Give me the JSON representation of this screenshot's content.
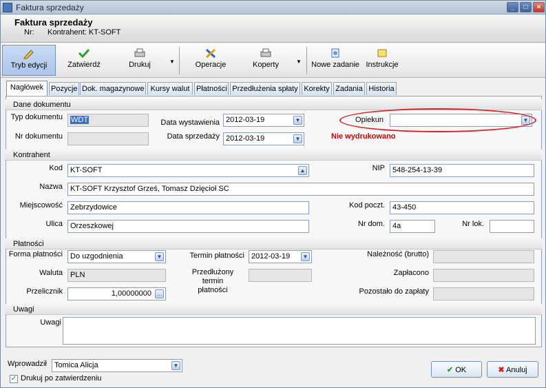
{
  "window": {
    "title": "Faktura sprzedaży",
    "controls": [
      "_",
      "□",
      "×"
    ]
  },
  "header": {
    "title": "Faktura sprzedaży",
    "nr_label": "Nr:",
    "kontrahent": "Kontrahent: KT-SOFT"
  },
  "toolbar": {
    "edit": "Tryb edycji",
    "approve": "Zatwierdź",
    "print": "Drukuj",
    "operations": "Operacje",
    "envelopes": "Koperty",
    "new_task": "Nowe zadanie",
    "instructions": "Instrukcje"
  },
  "tabs": [
    "Nagłówek",
    "Pozycje",
    "Dok. magazynowe",
    "Kursy walut",
    "Płatności",
    "Przedłużenia spłaty",
    "Korekty",
    "Zadania",
    "Historia"
  ],
  "dane": {
    "section": "Dane dokumentu",
    "typ_label": "Typ dokumentu",
    "typ_value": "WDT",
    "nr_label": "Nr dokumentu",
    "nr_value": "",
    "data_wyst_label": "Data wystawienia",
    "data_wyst_value": "2012-03-19",
    "data_sprz_label": "Data sprzedaży",
    "data_sprz_value": "2012-03-19",
    "opiekun_label": "Opiekun",
    "opiekun_value": "",
    "status": "Nie wydrukowano"
  },
  "kontrahent": {
    "section": "Kontrahent",
    "kod_label": "Kod",
    "kod_value": "KT-SOFT",
    "nip_label": "NIP",
    "nip_value": "548-254-13-39",
    "nazwa_label": "Nazwa",
    "nazwa_value": "KT-SOFT Krzysztof Grześ, Tomasz Dzięcioł SC",
    "miejsc_label": "Miejscowość",
    "miejsc_value": "Zebrzydowice",
    "kodp_label": "Kod poczt.",
    "kodp_value": "43-450",
    "ulica_label": "Ulica",
    "ulica_value": "Orzeszkowej",
    "nrdom_label": "Nr dom.",
    "nrdom_value": "4a",
    "nrlok_label": "Nr lok.",
    "nrlok_value": ""
  },
  "platnosci": {
    "section": "Płatności",
    "forma_label": "Forma płatności",
    "forma_value": "Do uzgodnienia",
    "termin_label": "Termin płatności",
    "termin_value": "2012-03-19",
    "naleznosc_label": "Należność (brutto)",
    "naleznosc_value": "",
    "waluta_label": "Waluta",
    "waluta_value": "PLN",
    "przedl_label1": "Przedłużony",
    "przedl_label2": "termin",
    "przedl_label3": "płatności",
    "przedl_value": "",
    "zaplacono_label": "Zapłacono",
    "zaplacono_value": "",
    "przelicznik_label": "Przelicznik",
    "przelicznik_value": "1,00000000",
    "pozostalo_label": "Pozostało do zapłaty",
    "pozostalo_value": ""
  },
  "uwagi": {
    "section": "Uwagi",
    "label": "Uwagi",
    "value": ""
  },
  "footer": {
    "wprowadzil_label": "Wprowadził",
    "wprowadzil_value": "Tomica Alicja",
    "print_after": "Drukuj po zatwierdzeniu",
    "print_after_checked": true,
    "ok": "OK",
    "cancel": "Anuluj"
  }
}
